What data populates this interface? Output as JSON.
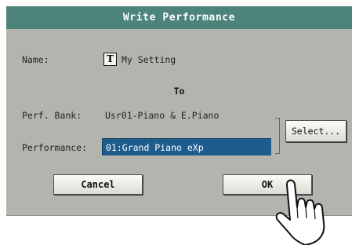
{
  "dialog": {
    "title": "Write Performance",
    "name_label": "Name:",
    "name_icon_glyph": "T",
    "name_value": "My Setting",
    "to_label": "To",
    "bank_label": "Perf. Bank:",
    "bank_value": "Usr01-Piano & E.Piano",
    "performance_label": "Performance:",
    "performance_value": "01:Grand Piano eXp",
    "select_label": "Select...",
    "cancel_label": "Cancel",
    "ok_label": "OK"
  },
  "colors": {
    "titlebar": "#4c837a",
    "dialog_bg": "#b4b4ae",
    "field_selected": "#1e5c8e"
  },
  "icons": {
    "name_edit": "text-edit-icon",
    "pointer": "touch-hand-icon"
  }
}
